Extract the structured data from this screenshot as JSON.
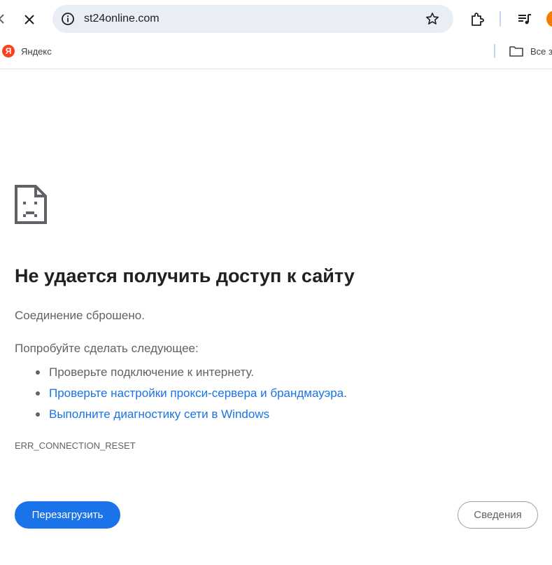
{
  "browser": {
    "url": "st24online.com",
    "bookmarks": [
      {
        "label": "Яндекс",
        "logo_letter": "Я"
      },
      {
        "label": "Все з"
      }
    ],
    "colors": {
      "omnibox_bg": "#e9eef6",
      "avatar": "#f57c00",
      "yandex_red": "#fc3f1d"
    }
  },
  "error_page": {
    "title": "Не удается получить доступ к сайту",
    "description": "Соединение сброшено.",
    "suggestions_heading": "Попробуйте сделать следующее:",
    "suggestions": [
      {
        "text": "Проверьте подключение к интернету.",
        "link": false
      },
      {
        "text": "Проверьте настройки прокси-сервера и брандмауэра",
        "link": true,
        "suffix": "."
      },
      {
        "text": "Выполните диагностику сети в Windows",
        "link": true
      }
    ],
    "error_code": "ERR_CONNECTION_RESET",
    "reload_label": "Перезагрузить",
    "details_label": "Сведения",
    "icon": "sad-page-icon",
    "colors": {
      "primary": "#1a73e8",
      "text": "#202124",
      "secondary_text": "#5f6368"
    }
  }
}
